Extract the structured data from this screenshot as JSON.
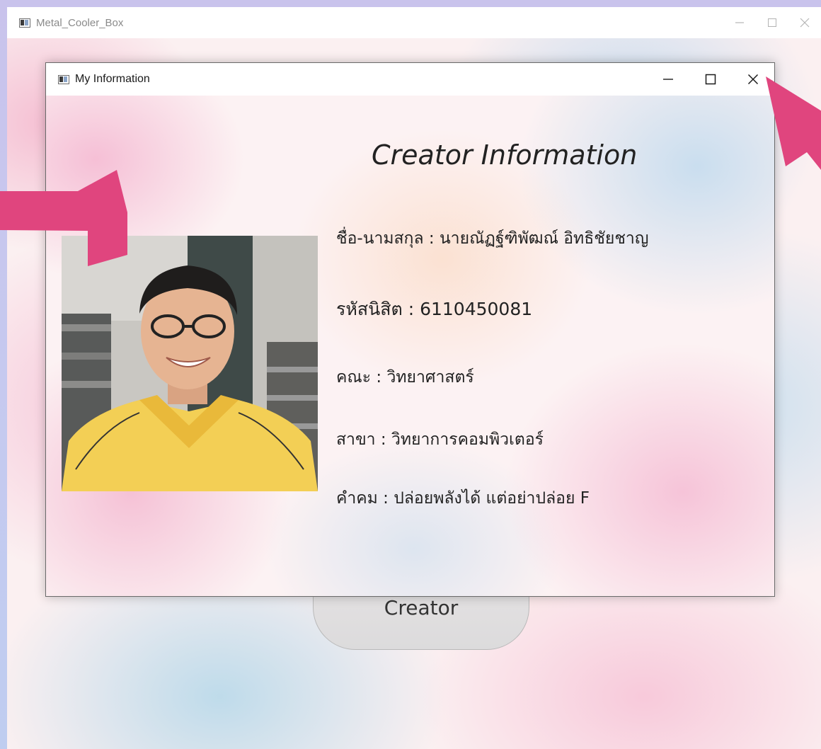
{
  "outer_window": {
    "title": "Metal_Cooler_Box",
    "icon": "app-window-icon"
  },
  "creator_button": {
    "label": "Creator"
  },
  "dialog": {
    "title": "My Information",
    "heading": "Creator Information",
    "fields": {
      "name": "ชื่อ-นามสกุล : นายณัฏฐ์ฑิพัฒณ์ อิทธิชัยชาญ",
      "student_id": "รหัสนิสิต : 6110450081",
      "faculty": "คณะ : วิทยาศาสตร์",
      "major": "สาขา : วิทยาการคอมพิวเตอร์",
      "motto": "คำคม : ปล่อยพลังได้  แต่อย่าปล่อย F"
    }
  },
  "colors": {
    "arrow": "#e0457e",
    "shirt": "#f3cf55"
  }
}
